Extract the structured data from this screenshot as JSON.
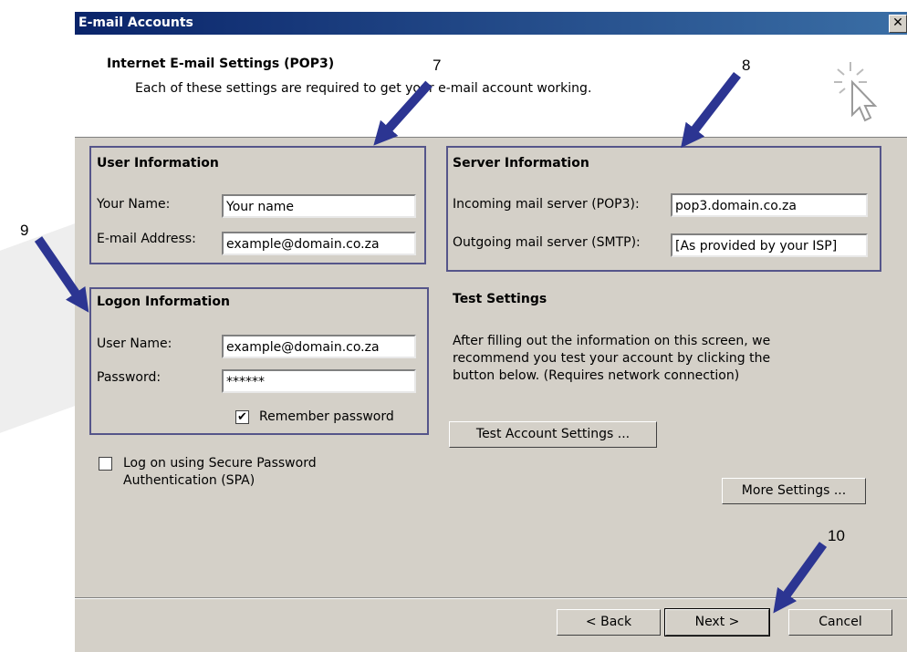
{
  "window": {
    "title": "E-mail Accounts",
    "close_glyph": "✕"
  },
  "header": {
    "title": "Internet E-mail Settings (POP3)",
    "subtitle": "Each of these settings are required to get your e-mail account working.",
    "icon": "cursor-sparkle-icon"
  },
  "user_info": {
    "title": "User Information",
    "name_label": "Your Name:",
    "name_value": "Your name",
    "email_label": "E-mail Address:",
    "email_value": "example@domain.co.za"
  },
  "server_info": {
    "title": "Server Information",
    "incoming_label": "Incoming mail server (POP3):",
    "incoming_value": "pop3.domain.co.za",
    "outgoing_label": "Outgoing mail server (SMTP):",
    "outgoing_value": "[As provided by your ISP]"
  },
  "logon_info": {
    "title": "Logon Information",
    "username_label": "User Name:",
    "username_value": "example@domain.co.za",
    "password_label": "Password:",
    "password_value": "******",
    "remember_label": "Remember password",
    "remember_checked": true,
    "spa_label_line1": "Log on using Secure Password",
    "spa_label_line2": "Authentication (SPA)",
    "spa_checked": false
  },
  "test_settings": {
    "title": "Test Settings",
    "line1": "After filling out the information on this screen, we",
    "line2": "recommend you test your account by clicking the",
    "line3": "button below. (Requires network connection)",
    "test_button": "Test Account Settings ...",
    "more_button": "More Settings ..."
  },
  "footer": {
    "back": "< Back",
    "next": "Next >",
    "cancel": "Cancel"
  },
  "annotations": {
    "a7": "7",
    "a8": "8",
    "a9": "9",
    "a10": "10",
    "arrow_color": "#2c3592"
  }
}
